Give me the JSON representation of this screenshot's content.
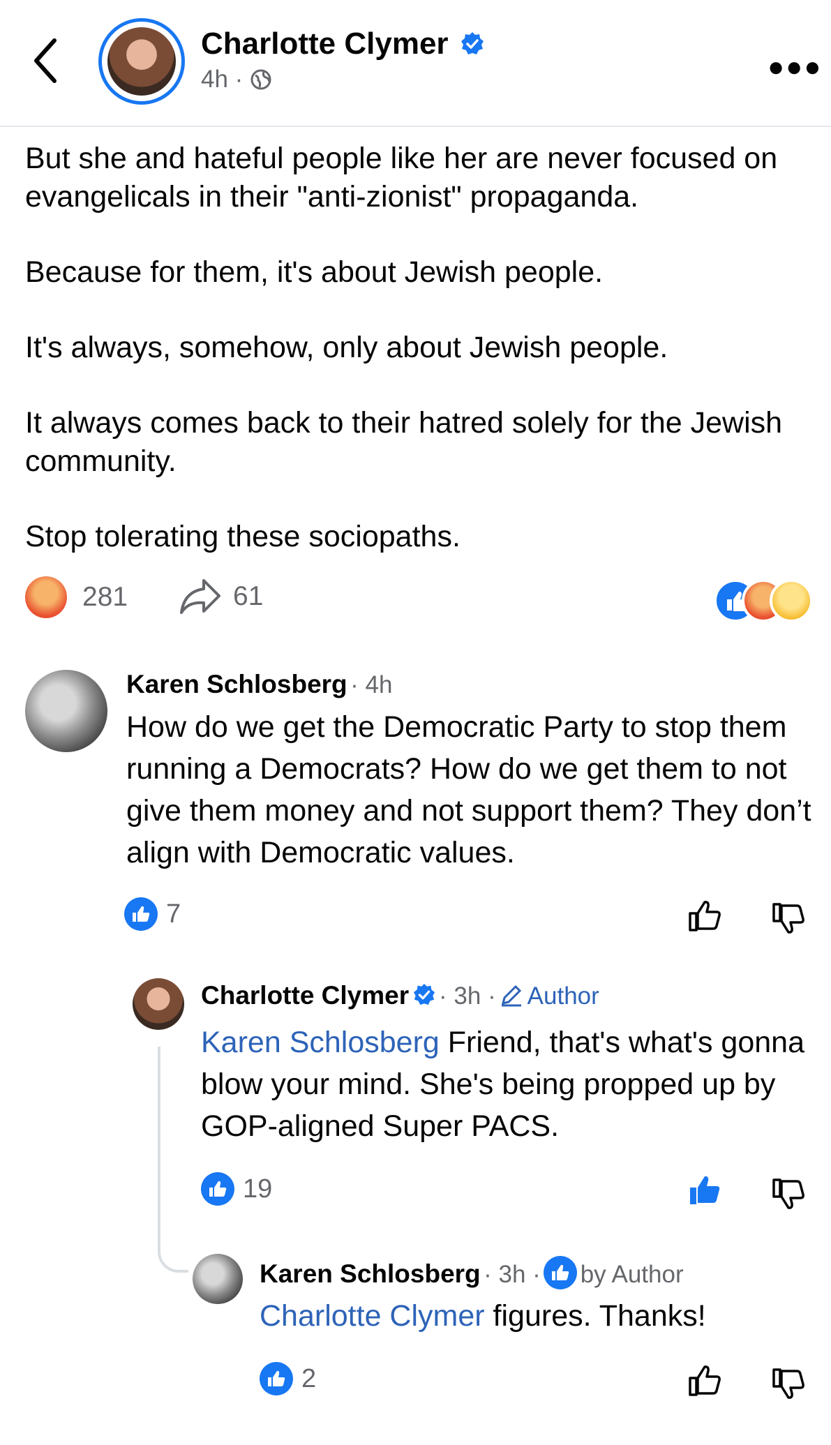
{
  "header": {
    "author_name": "Charlotte Clymer",
    "time": "4h",
    "separator": "·"
  },
  "post": {
    "paragraphs": [
      "But she and hateful people like her are never focused on evangelicals in their \"anti-zionist\" propaganda.",
      "Because for them, it's about Jewish people.",
      "It's always, somehow, only about Jewish people.",
      "It always comes back to their hatred solely for the Jewish community.",
      "Stop tolerating these sociopaths."
    ],
    "reaction_count": "281",
    "share_count": "61",
    "reaction_icons": [
      "like-icon",
      "angry-icon",
      "wow-icon"
    ]
  },
  "comments": [
    {
      "author": "Karen Schlosberg",
      "time": "· 4h",
      "text": "How do we get the Democratic Party to stop them running a Democrats? How do we get them to not give them money and not support them? They don’t align with Democratic values.",
      "likes": "7"
    },
    {
      "author": "Charlotte Clymer",
      "time": "· 3h ·",
      "tag": "Author",
      "mention": "Karen Schlosberg",
      "text": " Friend, that's what's gonna blow your mind. She's being propped up by GOP-aligned Super PACS.",
      "likes": "19"
    },
    {
      "author": "Karen Schlosberg",
      "time": "· 3h ·",
      "tag": "by Author",
      "mention": "Charlotte Clymer",
      "text": " figures. Thanks!",
      "likes": "2"
    }
  ],
  "colors": {
    "accent": "#1877f2",
    "mention": "#2d63b8",
    "muted": "#65676b"
  }
}
